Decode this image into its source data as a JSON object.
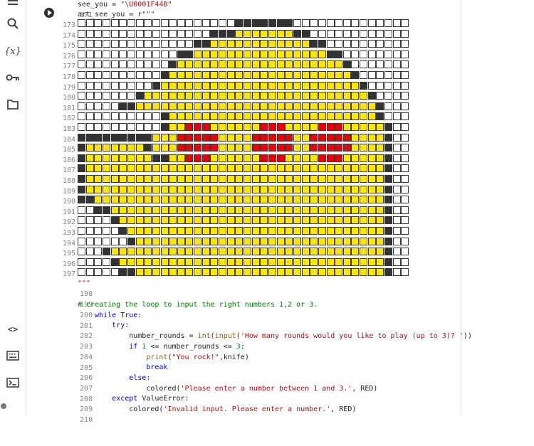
{
  "sidebar": {
    "items": [
      {
        "name": "toc-icon"
      },
      {
        "name": "search-icon"
      },
      {
        "name": "variables-icon",
        "label": "{x}"
      },
      {
        "name": "secrets-key-icon"
      },
      {
        "name": "files-folder-icon"
      },
      {
        "name": "code-snippets-icon",
        "label": "<>"
      },
      {
        "name": "command-palette-icon"
      },
      {
        "name": "terminal-icon"
      }
    ]
  },
  "editor": {
    "top_lines": [
      {
        "n": "171",
        "code": "see_you = \"\\U0001F44B\""
      },
      {
        "n": "172",
        "code": "art_see_you = r\"\"\""
      }
    ],
    "art_line_numbers": [
      "173",
      "174",
      "175",
      "176",
      "177",
      "178",
      "179",
      "180",
      "181",
      "182",
      "183",
      "184",
      "185",
      "186",
      "187",
      "188",
      "189",
      "190",
      "191",
      "192",
      "193",
      "194",
      "195",
      "196",
      "197"
    ],
    "pixel_art": [
      "0000000000000000000111111100000000000000",
      "0000000000000000111222222211000000000000",
      "0000000000000011222222222222110000000000",
      "0000000000001122222222222222221100000000",
      "0000000000012222222222222222222210000000",
      "0000000000122222222222222222222221000000",
      "0000000001222222222222222222222222100000",
      "0000000122222222222222222222222222210000",
      "0000011222222222222222222222222222221000",
      "0000000000122222222222222222222222221000",
      "0000000000122333222222333222233322222100",
      "1111111112223333322223333322333332222100",
      "1222222212223333322223333322333332222100",
      "1222222221122333222222333222233322222100",
      "1222222222222222222222222222222222222100",
      "1222222222222222222222222222222222222100",
      "1222222222222222222222222222222222222100",
      "1122222222222222222222222222222222222100",
      "0011222222222222222222222222222222222100",
      "0000122222222222222222222222222222222100",
      "0000012222222222222222222222222222222100",
      "0000001222222222222222222222222222222100",
      "0001222222222222222222222222222222222100",
      "0000122222222222222222222222222222222100",
      "0000011222222222222222222222222222222100"
    ],
    "bottom_lines": [
      {
        "n": "198",
        "code": "\"\"\""
      },
      {
        "n": "199",
        "code": ""
      },
      {
        "n": "200",
        "code": "# creating the loop to input the right numbers 1,2 or 3."
      },
      {
        "n": "201",
        "code": "    while True:"
      },
      {
        "n": "202",
        "code": "        try:"
      },
      {
        "n": "203",
        "code": "            number_rounds = int(input('How many rounds would you like to play (up to 3)? '))"
      },
      {
        "n": "204",
        "code": "            if 1 <= number_rounds <= 3:"
      },
      {
        "n": "205",
        "code": "                print(\"You rock!\",knife)"
      },
      {
        "n": "206",
        "code": "                break"
      },
      {
        "n": "207",
        "code": "            else:"
      },
      {
        "n": "208",
        "code": "                colored('Please enter a number between 1 and 3.', RED)"
      },
      {
        "n": "209",
        "code": "        except ValueError:"
      },
      {
        "n": "210",
        "code": "            colored('Invalid input. Please enter a number.', RED)"
      }
    ]
  },
  "colors": {
    "empty": "#ffffff",
    "outline": "#333333",
    "body": "#ffe600",
    "cheek": "#e8000b"
  }
}
